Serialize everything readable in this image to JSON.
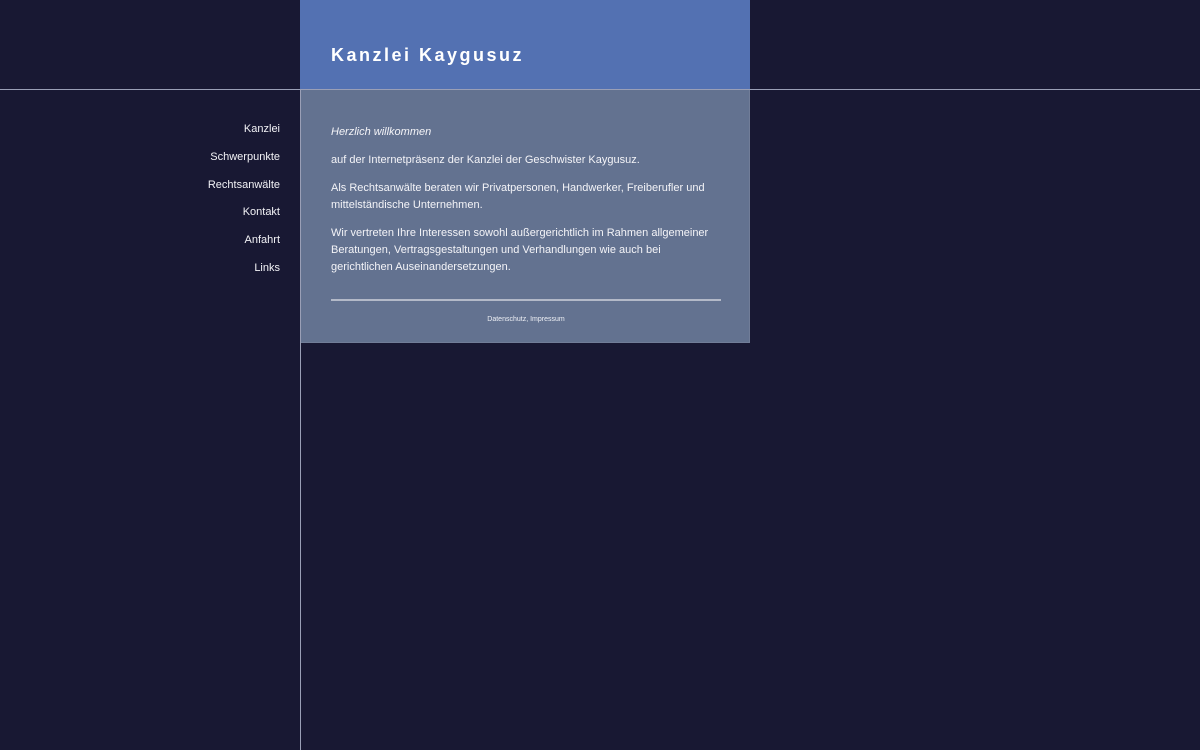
{
  "header": {
    "site_title": "Kanzlei Kaygusuz"
  },
  "nav": {
    "items": [
      {
        "label": "Kanzlei"
      },
      {
        "label": "Schwerpunkte"
      },
      {
        "label": "Rechtsanwälte"
      },
      {
        "label": "Kontakt"
      },
      {
        "label": "Anfahrt"
      },
      {
        "label": "Links"
      }
    ]
  },
  "content": {
    "welcome": "Herzlich willkommen",
    "paragraphs": [
      "auf der Internetpräsenz der Kanzlei der Geschwister Kaygusuz.",
      "Als Rechtsanwälte beraten wir Privatpersonen, Handwerker, Freiberufler und mittelständische Unternehmen.",
      "Wir vertreten Ihre Interessen sowohl außergerichtlich im Rahmen allgemeiner Beratungen, Vertragsgestaltungen und Verhandlungen wie auch bei gerichtlichen Auseinandersetzungen."
    ]
  },
  "footer": {
    "datenschutz": "Datenschutz",
    "separator": ", ",
    "impressum": "Impressum"
  },
  "colors": {
    "background": "#181833",
    "header": "#5371b2",
    "content_box": "#637290",
    "lines": "#9a9fb6"
  }
}
